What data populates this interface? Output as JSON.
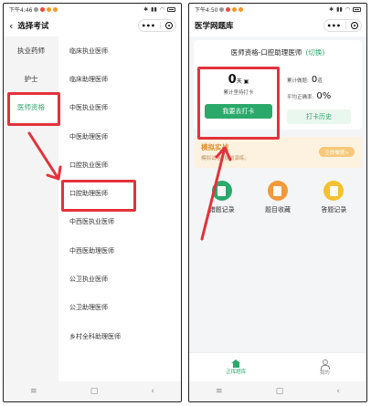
{
  "left": {
    "status": {
      "time": "下午4:46"
    },
    "title": "选择考试",
    "capsule_more": "•••",
    "sidebar": [
      {
        "label": "执业药师"
      },
      {
        "label": "护士"
      },
      {
        "label": "医师资格"
      }
    ],
    "exams": [
      {
        "label": "临床执业医师"
      },
      {
        "label": "临床助理医师"
      },
      {
        "label": "中医执业医师"
      },
      {
        "label": "中医助理医师"
      },
      {
        "label": "口腔执业医师"
      },
      {
        "label": "口腔助理医师"
      },
      {
        "label": "中西医执业医师"
      },
      {
        "label": "中西医助理医师"
      },
      {
        "label": "公卫执业医师"
      },
      {
        "label": "公卫助理医师"
      },
      {
        "label": "乡村全科助理医师"
      }
    ],
    "nav": {
      "menu": "≡",
      "home": "▢",
      "back": "‹"
    }
  },
  "right": {
    "status": {
      "time": "下午4:50"
    },
    "title": "医学网题库",
    "capsule_more": "•••",
    "subject": "医师资格-口腔助理医师",
    "switch": "(切换)",
    "checkin": {
      "days": "0",
      "unit": "天",
      "caption": "累计坚持打卡",
      "button": "我要去打卡"
    },
    "metrics": [
      {
        "label": "累计做题:",
        "value": "0",
        "unit": "道"
      },
      {
        "label": "平均正确率:",
        "value": "0%",
        "unit": ""
      }
    ],
    "history_button": "打卡历史",
    "banner": {
      "title": "模拟实战",
      "subtitle": "模拟试卷, 提前演练。",
      "button": "立即做题>"
    },
    "tools": [
      {
        "label": "错题记录",
        "icon": "wrong-record-icon",
        "color": "#2aa96b"
      },
      {
        "label": "题目收藏",
        "icon": "favorite-icon",
        "color": "#f2993a"
      },
      {
        "label": "答题记录",
        "icon": "answer-record-icon",
        "color": "#f5c12e"
      }
    ],
    "tabs": [
      {
        "label": "正挥题库",
        "icon": "home-icon"
      },
      {
        "label": "我的",
        "icon": "person-icon"
      }
    ],
    "nav": {
      "menu": "≡",
      "home": "▢",
      "back": "‹"
    }
  },
  "colors": {
    "accent": "#2aa96b",
    "highlight": "#e2333b"
  }
}
